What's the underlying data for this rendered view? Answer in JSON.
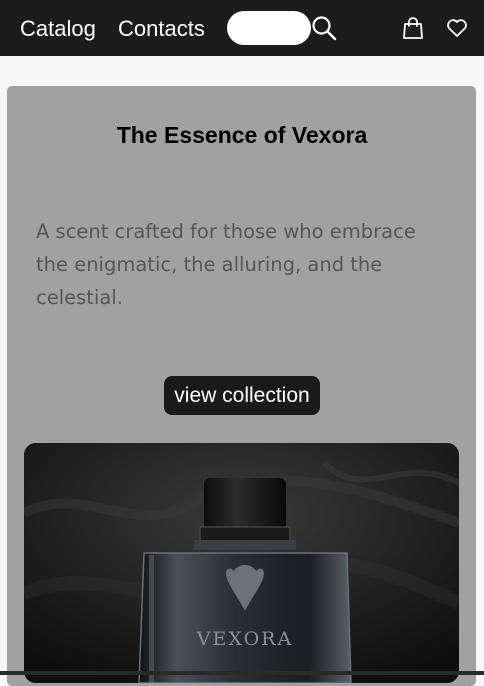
{
  "nav": {
    "links": [
      "Catalog",
      "Contacts"
    ],
    "search": {
      "value": "",
      "icon": "search-icon"
    },
    "icons": [
      "shopping-bag-icon",
      "heart-icon"
    ]
  },
  "hero": {
    "title": "The Essence of Vexora",
    "description": "A scent crafted for those who embrace the enigmatic, the alluring, and the celestial.",
    "button_label": "view collection",
    "image": {
      "description": "dark perfume bottle on smoky background",
      "brand_text": "VEXORA"
    }
  },
  "colors": {
    "topbar": "#1c1c1c",
    "hero_bg": "#a1a1a1",
    "button_bg": "#1a1a1a",
    "text_muted": "#555555"
  }
}
